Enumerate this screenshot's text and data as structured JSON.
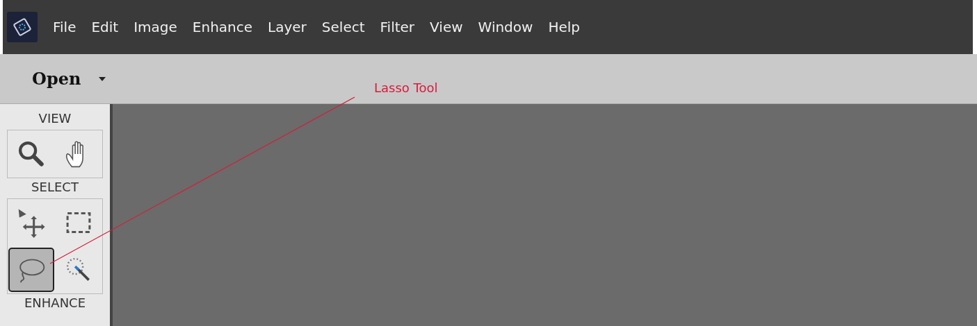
{
  "menu_bar": {
    "items": [
      "File",
      "Edit",
      "Image",
      "Enhance",
      "Layer",
      "Select",
      "Filter",
      "View",
      "Window",
      "Help"
    ]
  },
  "toolbar": {
    "mode": "Open"
  },
  "tool_panel": {
    "sections": [
      {
        "title": "VIEW",
        "tools": [
          {
            "kind": "zoom",
            "selected": false
          },
          {
            "kind": "hand",
            "selected": false
          }
        ]
      },
      {
        "title": "SELECT",
        "tools": [
          {
            "kind": "move",
            "selected": false
          },
          {
            "kind": "marquee",
            "selected": false
          },
          {
            "kind": "lasso",
            "selected": true
          },
          {
            "kind": "magic",
            "selected": false
          }
        ]
      },
      {
        "title": "ENHANCE"
      }
    ]
  },
  "annotation": {
    "label": "Lasso Tool"
  }
}
